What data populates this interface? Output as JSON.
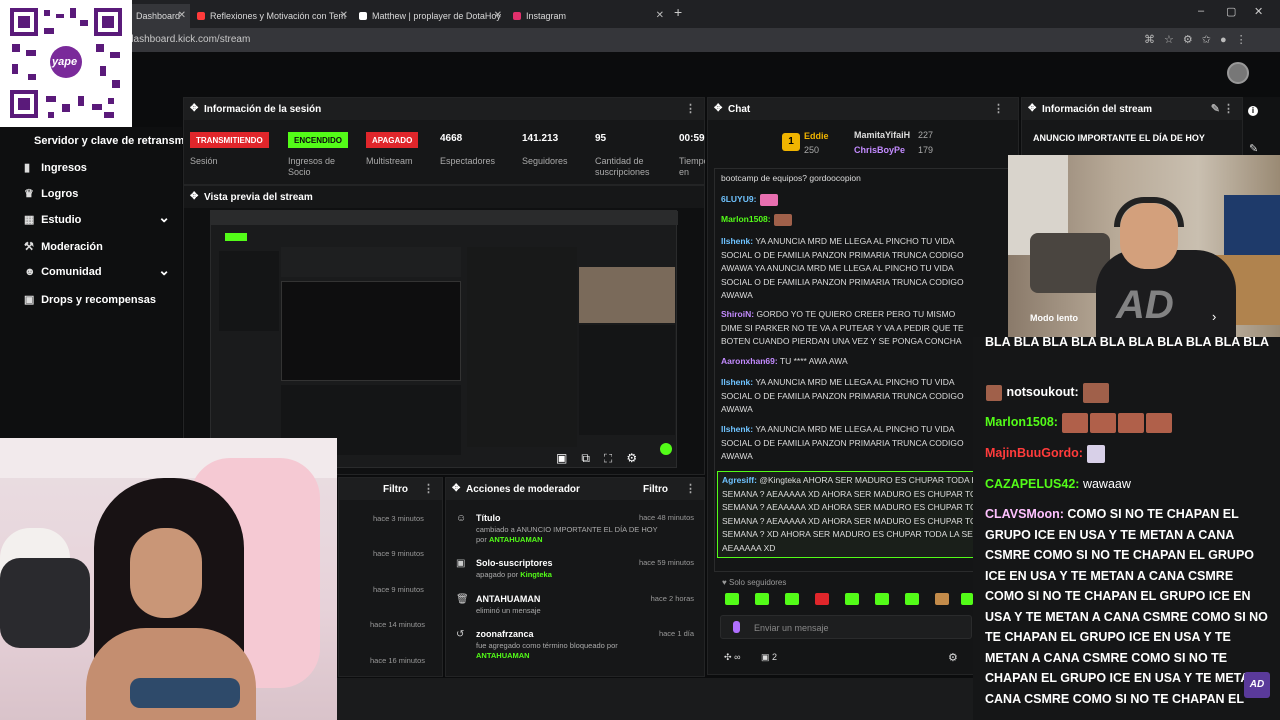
{
  "browser": {
    "tabs": [
      {
        "label": "Dashboard",
        "color": "#53fc18"
      },
      {
        "label": "Reflexiones y Motivación con Tem",
        "color": "#ff3b3b"
      },
      {
        "label": "Matthew | proplayer de DotaHoy",
        "color": "#ffffff"
      },
      {
        "label": "Instagram",
        "color": "#e1306c"
      }
    ],
    "new_tab": "+",
    "url": "dashboard.kick.com/stream",
    "window_controls": [
      "–",
      "▢",
      "✕"
    ]
  },
  "qr": {
    "brand": "yape"
  },
  "sidebar": {
    "stream_key_label": "Servidor y clave de retransm",
    "items": [
      {
        "label": "Ingresos",
        "icon": "chart-icon"
      },
      {
        "label": "Logros",
        "icon": "trophy-icon"
      },
      {
        "label": "Estudio",
        "icon": "grid-icon",
        "chevron": "⌄"
      },
      {
        "label": "Moderación",
        "icon": "hammer-icon"
      },
      {
        "label": "Comunidad",
        "icon": "people-icon",
        "chevron": "⌄"
      },
      {
        "label": "Drops y recompensas",
        "icon": "gift-icon"
      }
    ]
  },
  "session": {
    "title": "Información de la sesión",
    "badges": [
      {
        "text": "TRANSMITIENDO",
        "label": "Sesión",
        "color": "#e0262b"
      },
      {
        "text": "ENCENDIDO",
        "label": "Ingresos de Socio",
        "color": "#53fc18"
      },
      {
        "text": "APAGADO",
        "label": "Multistream",
        "color": "#e0262b"
      }
    ],
    "stats": [
      {
        "value": "4668",
        "label": "Espectadores"
      },
      {
        "value": "141.213",
        "label": "Seguidores"
      },
      {
        "value": "95",
        "label": "Cantidad de suscripciones"
      },
      {
        "value": "00:59",
        "label": "Tiempo en vivo"
      }
    ]
  },
  "preview": {
    "title": "Vista previa del stream"
  },
  "chat": {
    "title": "Chat",
    "top_gifters": [
      {
        "rank": "1",
        "name": "Eddie",
        "count": "250"
      },
      {
        "name": "MamitaYifaiH",
        "count": "227"
      },
      {
        "name": "ChrisBoyPe",
        "count": "179"
      }
    ],
    "messages": [
      {
        "user": "",
        "text": "bootcamp de equipos? gordoocopion"
      },
      {
        "user": "6LUYU9:",
        "text": ""
      },
      {
        "user": "Marlon1508:",
        "text": ""
      },
      {
        "user": "Ilshenk:",
        "text": "YA ANUNCIA MRD ME LLEGA AL PINCHO TU VIDA SOCIAL O DE FAMILIA PANZON PRIMARIA TRUNCA CODIGO AWAWA YA ANUNCIA MRD ME LLEGA AL PINCHO TU VIDA SOCIAL O DE FAMILIA PANZON PRIMARIA TRUNCA CODIGO AWAWA"
      },
      {
        "user": "ShiroiN:",
        "text": "GORDO YO TE QUIERO CREER PERO TU MISMO DIME SI PARKER NO TE VA A PUTEAR Y VA A PEDIR QUE TE BOTEN CUANDO PIERDAN UNA VEZ Y SE PONGA CONCHA"
      },
      {
        "user": "Aaronxhan69:",
        "text": "TU **** AWA AWA"
      },
      {
        "user": "Ilshenk:",
        "text": "YA ANUNCIA MRD ME LLEGA AL PINCHO TU VIDA SOCIAL O DE FAMILIA PANZON PRIMARIA TRUNCA CODIGO AWAWA"
      },
      {
        "user": "Ilshenk:",
        "text": "YA ANUNCIA MRD ME LLEGA AL PINCHO TU VIDA SOCIAL O DE FAMILIA PANZON PRIMARIA TRUNCA CODIGO AWAWA"
      },
      {
        "user": "Agresiff:",
        "text": "@Kingteka AHORA SER MADURO ES CHUPAR TODA LA SEMANA ? AEAAAAA XD AHORA SER MADURO ES CHUPAR TODA LA SEMANA ? AEAAAAA XD AHORA SER MADURO ES CHUPAR TODA LA SEMANA ? AEAAAAA XD AHORA SER MADURO ES CHUPAR TODA LA SEMANA ? XD AHORA SER MADURO ES CHUPAR TODA LA SEMANA ? AEAAAAA XD"
      }
    ],
    "followers_only": "Solo seguidores",
    "input_placeholder": "Enviar un mensaje",
    "viewer_count": "2",
    "infinity": "∞"
  },
  "stream_info": {
    "title": "Información del stream",
    "announcement": "ANUNCIO IMPORTANTE EL DÍA DE HOY",
    "slow_mode": "Modo lento"
  },
  "overlay_chat": {
    "lines": [
      {
        "user": "",
        "text": "BLA BLA BLA BLA BLA BLA BLA BLA BLA BLA",
        "style": "bu1"
      },
      {
        "user": "notsoukout:",
        "text": "",
        "style": "bu1"
      },
      {
        "user": "Marlon1508:",
        "text": "",
        "style": "bu2"
      },
      {
        "user": "MajinBuuGordo:",
        "text": "",
        "style": "bu3"
      },
      {
        "user": "CAZAPELUS42:",
        "text": "wawaaw",
        "style": "bu2"
      },
      {
        "user": "CLAVSMoon:",
        "text": "COMO SI NO TE CHAPAN EL GRUPO ICE EN USA Y TE METAN A CANA CSMRE COMO SI NO TE CHAPAN EL GRUPO ICE EN USA Y TE METAN A CANA CSMRE COMO SI NO TE CHAPAN EL GRUPO ICE EN USA Y TE METAN A CANA CSMRE COMO SI NO TE CHAPAN EL GRUPO ICE EN USA Y TE METAN A CANA CSMRE COMO SI NO TE CHAPAN EL GRUPO ICE EN USA Y TE METAN A CANA CSMRE COMO SI NO TE CHAPAN EL",
        "style": "bu3"
      }
    ]
  },
  "activity": {
    "filter_label": "Filtro",
    "times": [
      "hace 3 minutos",
      "hace 9 minutos",
      "hace 9 minutos",
      "hace 14 minutos",
      "hace 16 minutos"
    ]
  },
  "mod_actions": {
    "title": "Acciones de moderador",
    "filter_label": "Filtro",
    "rows": [
      {
        "title": "Título",
        "line1": "cambiado a ANUNCIO IMPORTANTE EL DÍA DE HOY",
        "line2": "por",
        "user": "ANTAHUAMAN",
        "time": "hace 48 minutos"
      },
      {
        "title": "Solo-suscriptores",
        "line1": "apagado por",
        "user": "Kingteka",
        "time": "hace 59 minutos"
      },
      {
        "title": "ANTAHUAMAN",
        "line1": "eliminó un mensaje",
        "user": "",
        "time": "hace 2 horas"
      },
      {
        "title": "zoonafrzanca",
        "line1": "fue agregado como término bloqueado por",
        "user": "ANTAHUAMAN",
        "time": "hace 1 día"
      }
    ]
  },
  "logo": "AD"
}
